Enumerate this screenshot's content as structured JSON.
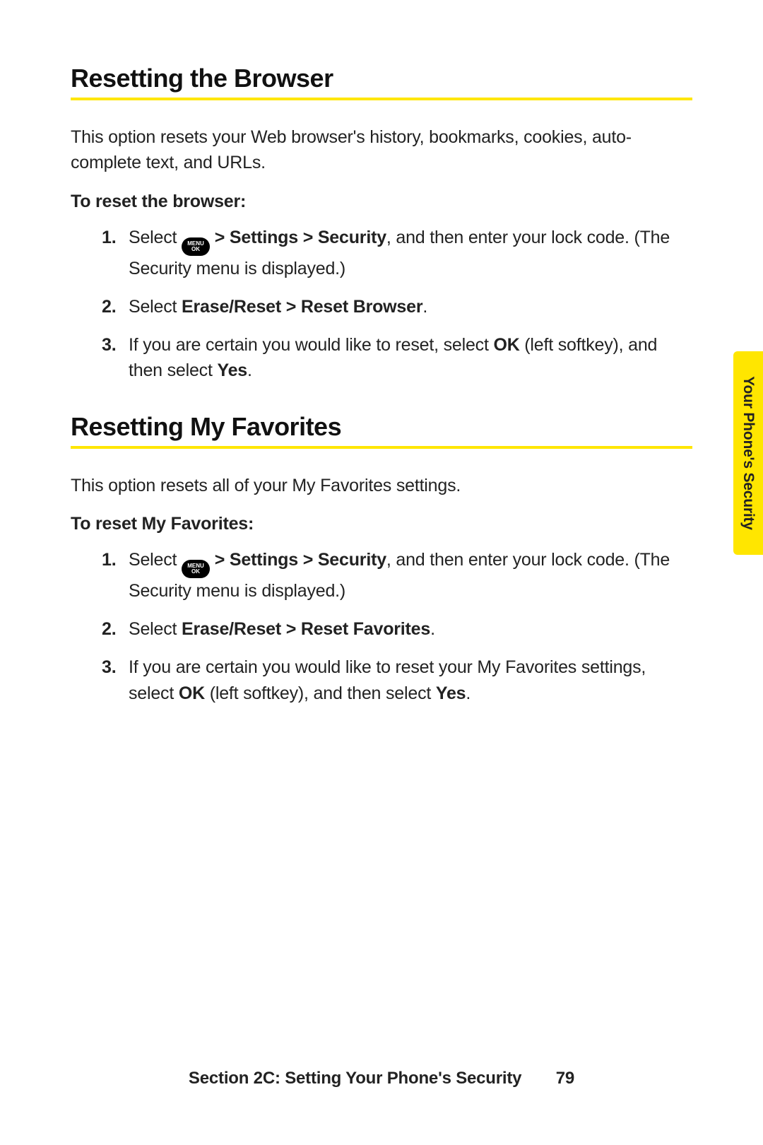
{
  "sideTab": "Your Phone's Security",
  "footer": {
    "text": "Section 2C: Setting Your Phone's Security",
    "page": "79"
  },
  "iconText": {
    "line1": "MENU",
    "line2": "OK"
  },
  "sections": [
    {
      "heading": "Resetting the Browser",
      "intro": "This option resets your Web browser's history, bookmarks, cookies, auto-complete text, and URLs.",
      "subhead": "To reset the browser:",
      "steps": [
        {
          "num": "1.",
          "pre": "Select ",
          "icon": true,
          "boldA": " > Settings > Security",
          "mid": ", and then enter your lock code. (The Security menu is displayed.)"
        },
        {
          "num": "2.",
          "pre": "Select ",
          "boldA": "Erase/Reset > Reset Browser",
          "mid": "."
        },
        {
          "num": "3.",
          "pre": "If you are certain you would like to reset, select ",
          "boldA": "OK",
          "mid": " (left softkey), and then select ",
          "boldB": "Yes",
          "post": "."
        }
      ]
    },
    {
      "heading": "Resetting My Favorites",
      "intro": "This option resets all of your My Favorites settings.",
      "subhead": "To reset My Favorites:",
      "steps": [
        {
          "num": "1.",
          "pre": "Select ",
          "icon": true,
          "boldA": " > Settings > Security",
          "mid": ", and then enter your lock code. (The Security menu is displayed.)"
        },
        {
          "num": "2.",
          "pre": "Select ",
          "boldA": "Erase/Reset > Reset Favorites",
          "mid": "."
        },
        {
          "num": "3.",
          "pre": " If you are certain you would like to reset your My Favorites settings, select ",
          "boldA": "OK",
          "mid": " (left softkey), and then select ",
          "boldB": "Yes",
          "post": "."
        }
      ]
    }
  ]
}
